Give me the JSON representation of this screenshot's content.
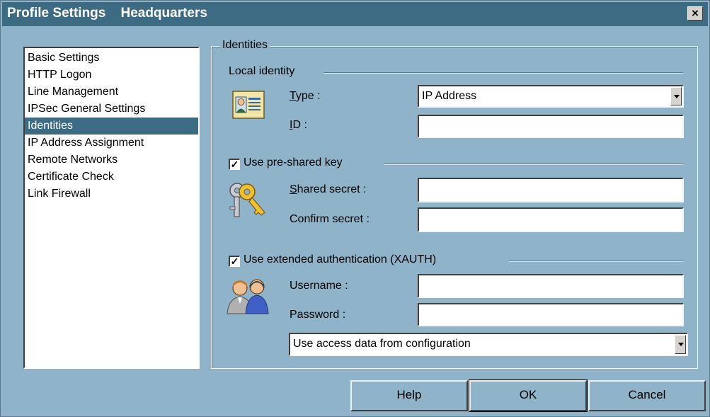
{
  "window": {
    "title": "Profile Settings    Headquarters",
    "close_glyph": "×"
  },
  "nav": {
    "items": [
      {
        "label": "Basic Settings",
        "selected": false
      },
      {
        "label": "HTTP Logon",
        "selected": false
      },
      {
        "label": "Line Management",
        "selected": false
      },
      {
        "label": "IPSec General Settings",
        "selected": false
      },
      {
        "label": "Identities",
        "selected": true
      },
      {
        "label": "IP Address Assignment",
        "selected": false
      },
      {
        "label": "Remote Networks",
        "selected": false
      },
      {
        "label": "Certificate Check",
        "selected": false
      },
      {
        "label": "Link Firewall",
        "selected": false
      }
    ]
  },
  "panel": {
    "group_title": "Identities",
    "local_identity": {
      "section_title": "Local identity",
      "type_label": "Type :",
      "type_value": "IP Address",
      "id_label": "ID :",
      "id_value": "",
      "icon": "id-card-icon"
    },
    "preshared": {
      "checkbox_label": "Use pre-shared key",
      "checked": true,
      "shared_secret_label": "Shared secret :",
      "shared_secret_value": "",
      "confirm_secret_label": "Confirm secret :",
      "confirm_secret_value": "",
      "icon": "keys-icon"
    },
    "xauth": {
      "checkbox_label": "Use extended authentication (XAUTH)",
      "checked": true,
      "username_label": "Username :",
      "username_value": "",
      "password_label": "Password :",
      "password_value": "",
      "access_mode_value": "Use access data from configuration",
      "icon": "users-icon"
    }
  },
  "buttons": {
    "help": "Help",
    "ok": "OK",
    "cancel": "Cancel"
  },
  "colors": {
    "window_bg": "#8fb3c8",
    "title_bg": "#3d6b83",
    "selection_bg": "#3d6b83"
  }
}
